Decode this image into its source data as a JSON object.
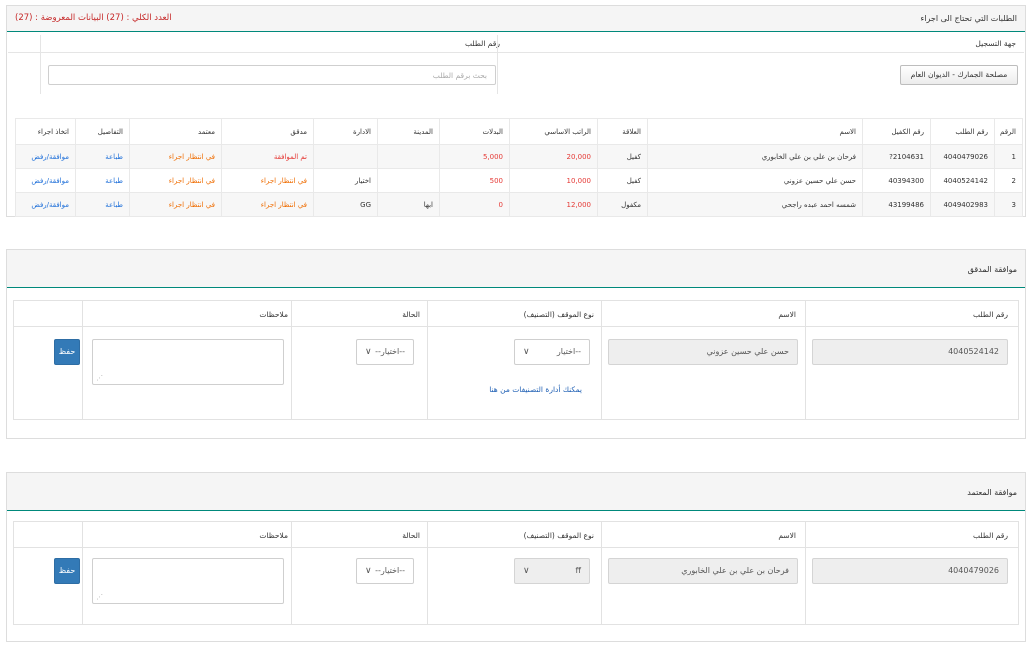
{
  "requests_panel": {
    "title": "الطلبات التي تحتاج الى اجراء",
    "count_text": "العدد الكلي : (27) البيانات المعروضة : (27)",
    "filter": {
      "entity_label": "جهة التسجيل",
      "entity_button": "مصلحة الجمارك - الديوان العام",
      "request_no_label": "رقم الطلب",
      "search_placeholder": "بحث برقم الطلب"
    },
    "columns": [
      "الرقم",
      "رقم الطلب",
      "رقم الكفيل",
      "الاسم",
      "العلاقة",
      "الراتب الاساسي",
      "البدلات",
      "المدينة",
      "الادارة",
      "مدقق",
      "معتمد",
      "التفاصيل",
      "اتخاذ اجراء"
    ],
    "rows": [
      {
        "num": "1",
        "request_no": "4040479026",
        "sponsor_no": "2104631?",
        "name": "فرحان بن علي بن علي الخابوري",
        "relation": "كفيل",
        "salary": "20,000",
        "allowance": "5,000",
        "city": "",
        "dept": "",
        "auditor": "تم الموافقة",
        "approver": "في انتظار اجراء",
        "details": "طباعة",
        "action": "موافقة/رفض"
      },
      {
        "num": "2",
        "request_no": "4040524142",
        "sponsor_no": "40394300",
        "name": "حسن علي حسين عزوني",
        "relation": "كفيل",
        "salary": "10,000",
        "allowance": "500",
        "city": "",
        "dept": "اختيار",
        "auditor": "في انتظار اجراء",
        "approver": "في انتظار اجراء",
        "details": "طباعة",
        "action": "موافقة/رفض"
      },
      {
        "num": "3",
        "request_no": "4049402983",
        "sponsor_no": "43199486",
        "name": "شمسه احمد عبده راجحي",
        "relation": "مكفول",
        "salary": "12,000",
        "allowance": "0",
        "city": "ابها",
        "dept": "GG",
        "auditor": "في انتظار اجراء",
        "approver": "في انتظار اجراء",
        "details": "طباعة",
        "action": "موافقة/رفض"
      }
    ]
  },
  "auditor_approval": {
    "title": "موافقة المدقق",
    "headers": {
      "request_no": "رقم الطلب",
      "name": "الاسم",
      "job_type": "نوع الموقف (التصنيف)",
      "status": "الحالة",
      "notes": "ملاحظات"
    },
    "request_no": "4040524142",
    "name": "حسن علي حسين عزوني",
    "job_type_value": "--اختيار",
    "status_value": "--اختيار--",
    "classification_link": "يمكنك أدارة التصنيفات من هنا",
    "save_label": "حفظ"
  },
  "approver_approval": {
    "title": "موافقة المعتمد",
    "headers": {
      "request_no": "رقم الطلب",
      "name": "الاسم",
      "job_type": "نوع الموقف (التصنيف)",
      "status": "الحالة",
      "notes": "ملاحظات"
    },
    "request_no": "4040479026",
    "name": "فرحان بن علي بن علي الخابوري",
    "job_type_value": "ff",
    "status_value": "--اختيار--",
    "save_label": "حفظ"
  },
  "colors": {
    "accent_line": "#00897b",
    "status_red": "#e53935",
    "status_orange": "#ef6c00",
    "link_blue": "#1e6fd9",
    "save_button": "#337ab7"
  },
  "icons": {
    "select_chevron": "chevron-down-icon",
    "textarea_grip": "resize-grip-icon"
  }
}
